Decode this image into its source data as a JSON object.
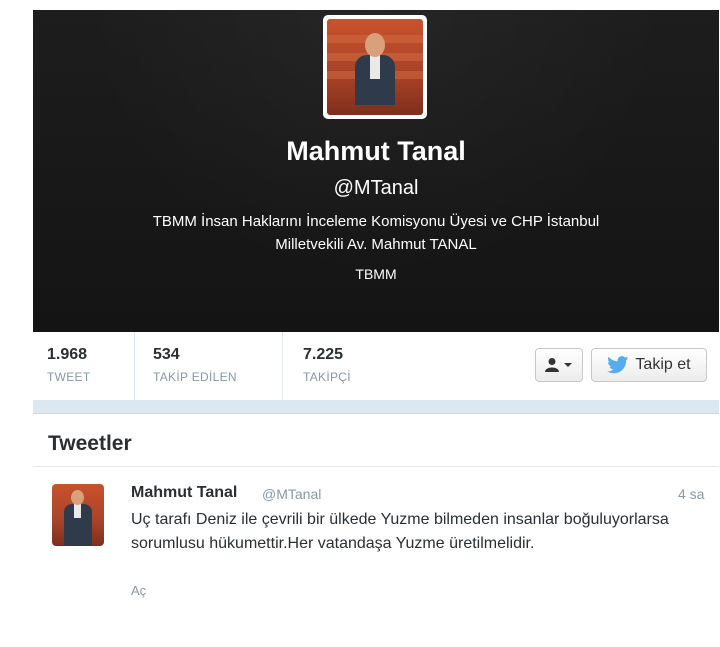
{
  "profile": {
    "name": "Mahmut Tanal",
    "handle": "@MTanal",
    "bio_line1": "TBMM İnsan Haklarını İnceleme Komisyonu Üyesi ve CHP İstanbul",
    "bio_line2": "Milletvekili Av. Mahmut TANAL",
    "location": "TBMM"
  },
  "stats": [
    {
      "value": "1.968",
      "label": "TWEET"
    },
    {
      "value": "534",
      "label": "TAKİP EDİLEN"
    },
    {
      "value": "7.225",
      "label": "TAKİPÇİ"
    }
  ],
  "actions": {
    "user_menu_icon": "user-dropdown-icon",
    "follow_label": "Takip et",
    "follow_icon": "twitter-bird-icon"
  },
  "tweets_section": {
    "title": "Tweetler",
    "items": [
      {
        "name": "Mahmut Tanal",
        "handle": "@MTanal",
        "time": "4 sa",
        "text": "Uç tarafı Deniz ile çevrili bir ülkede Yuzme bilmeden insanlar boğuluyorlarsa sorumlusu hükumettir.Her vatandaşa Yuzme üretilmelidir.",
        "expand_label": "Aç"
      }
    ]
  },
  "colors": {
    "header_bg": "#1a1a1a",
    "twitter_blue": "#55acee",
    "muted_text": "#8899a6"
  }
}
